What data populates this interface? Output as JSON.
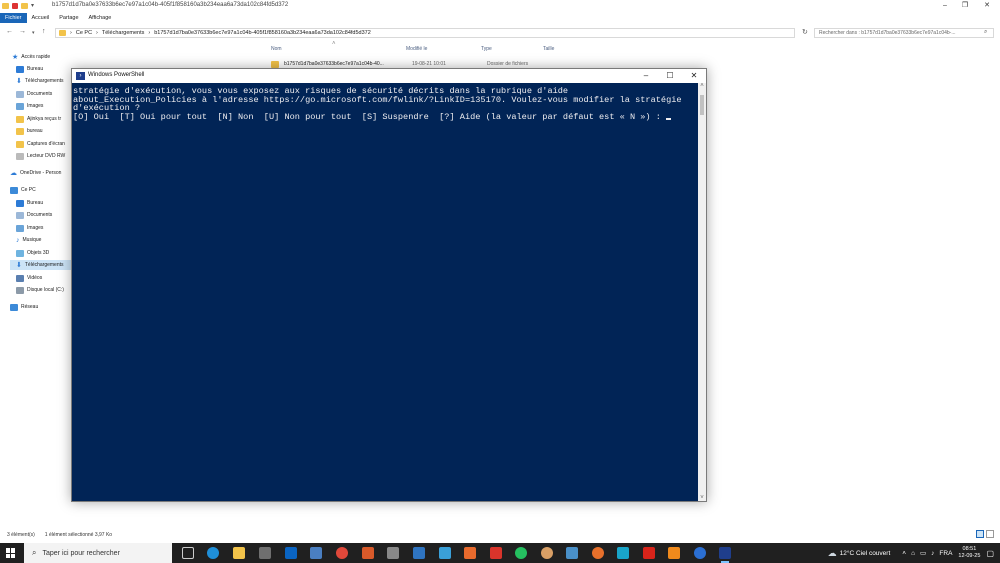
{
  "explorer": {
    "window_title": "b1757d1d7ba0e37633b6ec7e97a1c04b-405f1f858160a3b234eaa6a73da102c84fd5d372",
    "tabs": [
      "Fichier",
      "Accueil",
      "Partage",
      "Affichage"
    ],
    "breadcrumb": [
      "Ce PC",
      "Téléchargements",
      "b1757d1d7ba0e37633b6ec7e97a1c04b-405f1f858160a3b234eaa6a73da102c84fd5d372"
    ],
    "search_placeholder": "Rechercher dans : b1757d1d7ba0e37633b6ec7e97a1c04b-...",
    "nav": {
      "quick_access": "Accès rapide",
      "quick_items": [
        "Bureau",
        "Téléchargements",
        "Documents",
        "Images",
        "Ajinkya reçus tr",
        "bureau",
        "Captures d'écran",
        "Lecteur DVD RW"
      ],
      "onedrive": "OneDrive - Person",
      "this_pc": "Ce PC",
      "pc_items": [
        "Bureau",
        "Documents",
        "Images",
        "Musique",
        "Objets 3D",
        "Téléchargements",
        "Vidéos",
        "Disque local (C:)"
      ],
      "network": "Réseau"
    },
    "columns": {
      "name": "Nom",
      "modified": "Modifié le",
      "type": "Type",
      "size": "Taille"
    },
    "file": {
      "name": "b1757d1d7ba0e37633b6ec7e97a1c04b-40...",
      "modified": "19-08-21 10:01",
      "type": "Dossier de fichiers"
    },
    "status": {
      "count": "3 élément(s)",
      "selected": "1 élément sélectionné  3,97 Ko"
    }
  },
  "powershell": {
    "title": "Windows PowerShell",
    "lines": [
      "stratégie d'exécution, vous vous exposez aux risques de sécurité décrits dans la rubrique d'aide",
      "about_Execution_Policies à l'adresse https://go.microsoft.com/fwlink/?LinkID=135170. Voulez-vous modifier la stratégie",
      "d'exécution ?",
      "[O] Oui  [T] Oui pour tout  [N] Non  [U] Non pour tout  [S] Suspendre  [?] Aide (la valeur par défaut est « N ») : "
    ]
  },
  "taskbar": {
    "search_placeholder": "Taper ici pour rechercher",
    "weather": "12°C  Ciel couvert",
    "language": "FRA",
    "time": "08:51",
    "date": "12-09-25"
  },
  "colors": {
    "console_bg": "#012456",
    "accent": "#1a66b8"
  }
}
